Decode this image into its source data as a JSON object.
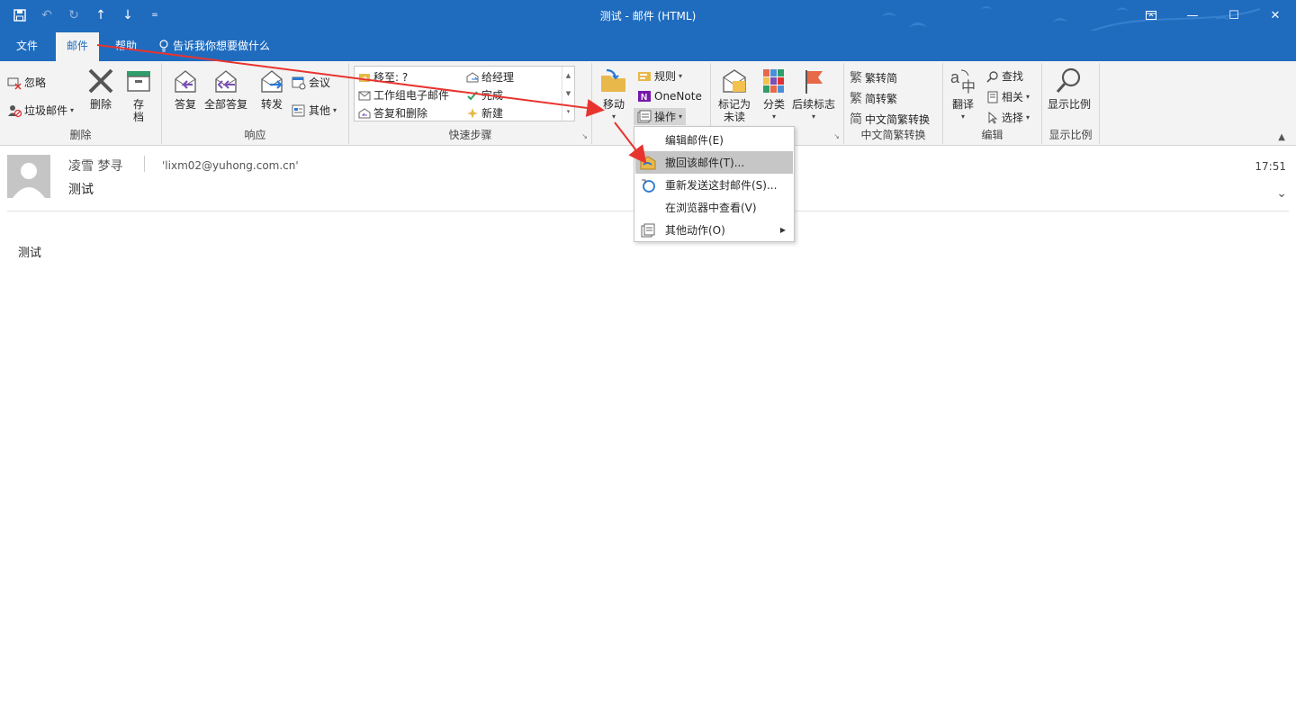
{
  "window": {
    "title": "测试 - 邮件 (HTML)"
  },
  "tabs": [
    {
      "label": "文件"
    },
    {
      "label": "邮件"
    },
    {
      "label": "帮助"
    }
  ],
  "tell_me": "告诉我你想要做什么",
  "ribbon": {
    "delete_group": {
      "label": "删除",
      "ignore": "忽略",
      "junk": "垃圾邮件",
      "delete": "删除",
      "archive_1": "存",
      "archive_2": "档"
    },
    "respond_group": {
      "label": "响应",
      "reply": "答复",
      "reply_all": "全部答复",
      "forward": "转发",
      "meeting": "会议",
      "more": "其他"
    },
    "quick_steps": {
      "label": "快速步骤",
      "items": [
        "移至: ?",
        "给经理",
        "工作组电子邮件",
        "完成",
        "答复和删除",
        "新建"
      ]
    },
    "move_group": {
      "move": "移动",
      "rules": "规则",
      "onenote": "OneNote",
      "actions": "操作"
    },
    "tags_group": {
      "mark_unread_1": "标记为",
      "mark_unread_2": "未读",
      "categorize": "分类",
      "follow_up": "后续标志"
    },
    "chinese_group": {
      "label": "中文简繁转换",
      "to_simplified": "繁转简",
      "to_traditional": "简转繁",
      "convert": "中文简繁转换"
    },
    "editing_group": {
      "label": "编辑",
      "translate": "翻译",
      "find": "查找",
      "related": "相关",
      "select": "选择"
    },
    "zoom_group": {
      "label": "显示比例",
      "zoom": "显示比例"
    }
  },
  "message": {
    "sender": "凌雪 梦寻",
    "email": "'lixm02@yuhong.com.cn'",
    "subject": "测试",
    "time": "17:51",
    "body": "测试"
  },
  "actions_menu": {
    "items": [
      {
        "label": "编辑邮件(E)"
      },
      {
        "label": "撤回该邮件(T)..."
      },
      {
        "label": "重新发送这封邮件(S)..."
      },
      {
        "label": "在浏览器中查看(V)"
      },
      {
        "label": "其他动作(O)"
      }
    ]
  },
  "colors": {
    "accent": "#1f6cbf",
    "ribbon_bg": "#f3f3f3",
    "arrow": "#e8342f",
    "highlight": "#c6c6c6"
  }
}
